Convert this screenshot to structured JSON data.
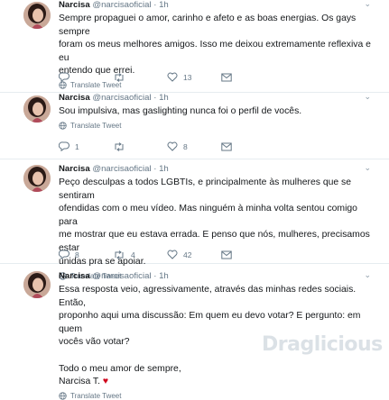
{
  "tweets": [
    {
      "name": "Narcisa",
      "handle": "@narcisaoficial",
      "time": "1h",
      "lines": [
        "Sempre propaguei o amor, carinho e afeto e as boas energias. Os gays sempre",
        "foram os meus melhores amigos. Isso me deixou extremamente reflexiva e eu",
        "entendo que errei."
      ],
      "translate": "Translate Tweet",
      "reply_count": "",
      "retweet_count": "",
      "like_count": "13"
    },
    {
      "name": "Narcisa",
      "handle": "@narcisaoficial",
      "time": "1h",
      "lines": [
        "Sou impulsiva, mas gaslighting nunca foi o perfil de vocês."
      ],
      "translate": "Translate Tweet",
      "reply_count": "1",
      "retweet_count": "",
      "like_count": "8"
    },
    {
      "name": "Narcisa",
      "handle": "@narcisaoficial",
      "time": "1h",
      "lines": [
        "Peço desculpas a todos LGBTIs, e principalmente às mulheres que se sentiram",
        "ofendidas com o meu vídeo. Mas ninguém à minha volta sentou comigo para",
        "me mostrar que eu estava errada. E penso que nós, mulheres, precisamos estar",
        "unidas pra se apoiar."
      ],
      "translate": "Translate Tweet",
      "reply_count": "8",
      "retweet_count": "4",
      "like_count": "42"
    },
    {
      "name": "Narcisa",
      "handle": "@narcisaoficial",
      "time": "1h",
      "lines": [
        "Essa resposta veio, agressivamente, através das minhas redes sociais. Então,",
        "proponho aqui uma discussão: Em quem eu devo votar? E pergunto: em quem",
        "vocês vão votar?"
      ],
      "closing": [
        "Todo o meu amor de sempre,",
        "Narcisa T."
      ],
      "heart": "♥",
      "translate": "Translate Tweet"
    }
  ],
  "watermark": "Draglicious",
  "colors": {
    "text": "#14171a",
    "muted": "#657786",
    "border": "#e6ecf0",
    "heart": "#d0021b"
  }
}
